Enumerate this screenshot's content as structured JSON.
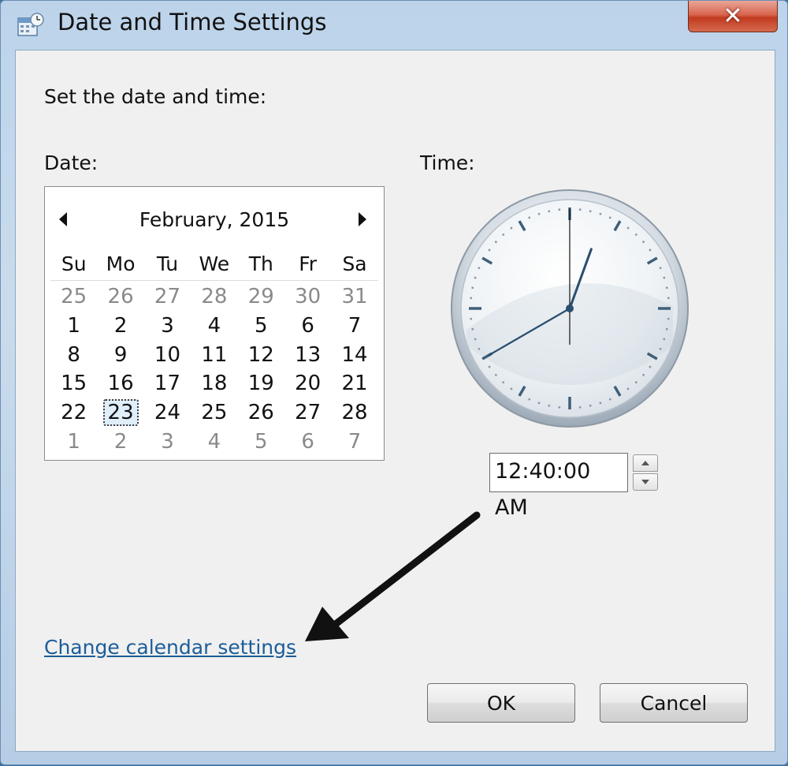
{
  "window": {
    "title": "Date and Time Settings",
    "close_glyph": "✕"
  },
  "labels": {
    "set": "Set the date and time:",
    "date": "Date:",
    "time": "Time:"
  },
  "calendar": {
    "month_title": "February, 2015",
    "weekdays": [
      "Su",
      "Mo",
      "Tu",
      "We",
      "Th",
      "Fr",
      "Sa"
    ],
    "weeks": [
      [
        "25",
        "26",
        "27",
        "28",
        "29",
        "30",
        "31"
      ],
      [
        "1",
        "2",
        "3",
        "4",
        "5",
        "6",
        "7"
      ],
      [
        "8",
        "9",
        "10",
        "11",
        "12",
        "13",
        "14"
      ],
      [
        "15",
        "16",
        "17",
        "18",
        "19",
        "20",
        "21"
      ],
      [
        "22",
        "23",
        "24",
        "25",
        "26",
        "27",
        "28"
      ],
      [
        "1",
        "2",
        "3",
        "4",
        "5",
        "6",
        "7"
      ]
    ],
    "selected_day": "23"
  },
  "time": {
    "value": "12:40:00 AM"
  },
  "link": {
    "change_calendar": "Change calendar settings"
  },
  "buttons": {
    "ok": "OK",
    "cancel": "Cancel"
  },
  "colors": {
    "link": "#1c5d99",
    "close": "#c23a1f",
    "titlebar": "#bcd3ea"
  },
  "icons": [
    "calendar-clock-icon",
    "close-icon",
    "chevron-left-icon",
    "chevron-right-icon",
    "spin-up-icon",
    "spin-down-icon",
    "annotation-arrow"
  ]
}
